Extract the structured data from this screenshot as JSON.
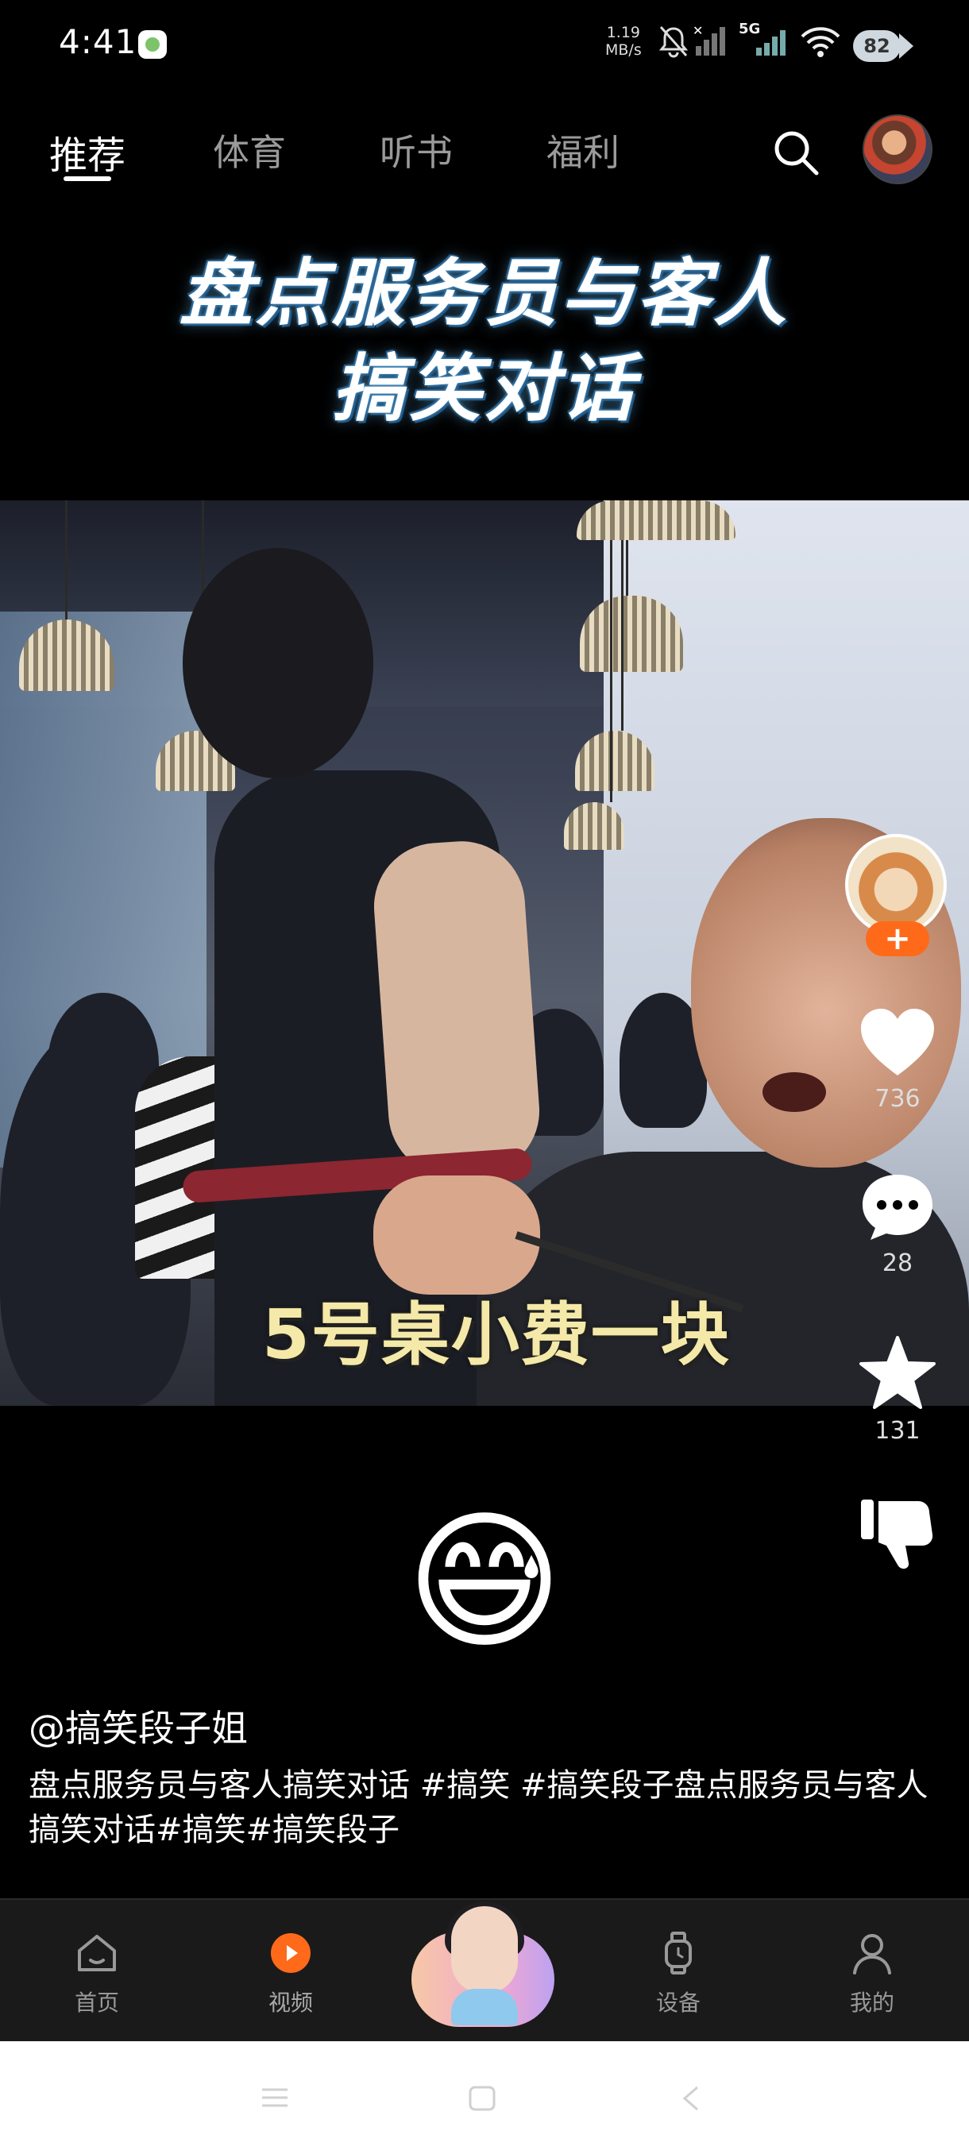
{
  "status_bar": {
    "time": "4:41",
    "net_speed_value": "1.19",
    "net_speed_unit": "MB/s",
    "network": "5G",
    "battery": "82",
    "icons": [
      "app-icon",
      "mute-icon",
      "signal-off-icon",
      "signal-5g-icon",
      "wifi-icon",
      "battery-icon"
    ]
  },
  "tabs": [
    {
      "label": "推荐",
      "active": true
    },
    {
      "label": "体育",
      "active": false
    },
    {
      "label": "听书",
      "active": false
    },
    {
      "label": "福利",
      "active": false
    }
  ],
  "video": {
    "title_line1": "盘点服务员与客人",
    "title_line2": "搞笑对话",
    "subtitle": "5号桌小费一块"
  },
  "actions": {
    "like_count": "736",
    "comment_count": "28",
    "favorite_count": "131",
    "follow_label": "+"
  },
  "emoji": "😅",
  "post": {
    "author": "@搞笑段子姐",
    "caption": "盘点服务员与客人搞笑对话 #搞笑 #搞笑段子盘点服务员与客人搞笑对话#搞笑#搞笑段子"
  },
  "bottom_nav": [
    {
      "label": "首页",
      "icon": "home-icon"
    },
    {
      "label": "视频",
      "icon": "video-play-icon",
      "active": true
    },
    {
      "label": "设备",
      "icon": "watch-icon"
    },
    {
      "label": "我的",
      "icon": "person-icon"
    }
  ],
  "colors": {
    "accent": "#ff6a1a",
    "background": "#000000",
    "nav_bg": "#1a1a1a"
  }
}
